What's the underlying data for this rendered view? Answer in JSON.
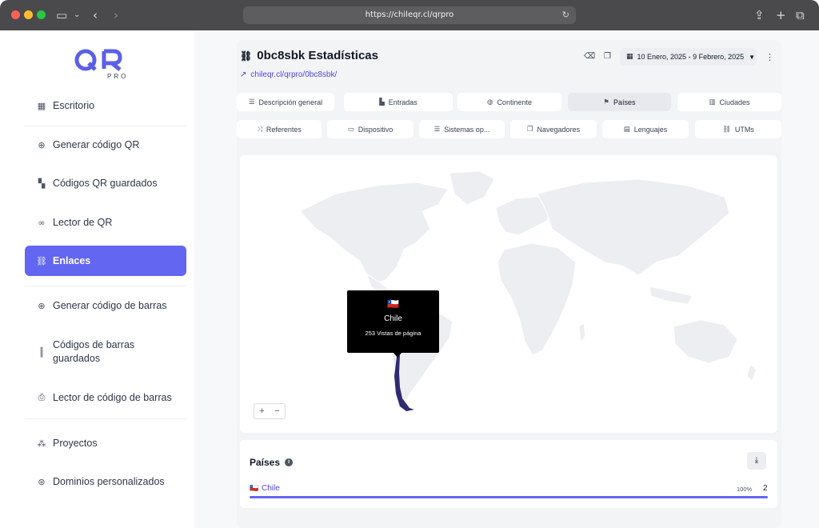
{
  "browser": {
    "url": "https://chileqr.cl/qrpro"
  },
  "sidebar": {
    "logo_text": "QR",
    "logo_sub": "PRO",
    "items": [
      {
        "label": "Escritorio",
        "icon": "table-icon"
      },
      {
        "label": "Generar código QR",
        "icon": "plus-circle-icon"
      },
      {
        "label": "Códigos QR guardados",
        "icon": "qrcode-icon"
      },
      {
        "label": "Lector de QR",
        "icon": "glasses-icon"
      },
      {
        "label": "Enlaces",
        "icon": "link-icon",
        "active": true
      },
      {
        "label": "Generar código de barras",
        "icon": "plus-circle-icon"
      },
      {
        "label": "Códigos de barras guardados",
        "icon": "barcode-icon"
      },
      {
        "label": "Lector de código de barras",
        "icon": "printer-icon"
      },
      {
        "label": "Proyectos",
        "icon": "project-icon"
      },
      {
        "label": "Dominios personalizados",
        "icon": "globe-icon"
      }
    ]
  },
  "header": {
    "title": "0bc8sbk Estadísticas",
    "link": "chileqr.cl/qrpro/0bc8sbk/",
    "date_range": "10 Enero, 2025 - 9 Febrero, 2025"
  },
  "tabs_row1": [
    {
      "label": "Descripción general",
      "icon": "list-icon"
    },
    {
      "label": "Entradas",
      "icon": "chart-icon"
    },
    {
      "label": "Continente",
      "icon": "globe-icon"
    },
    {
      "label": "Países",
      "icon": "flag-icon",
      "active": true
    },
    {
      "label": "Ciudades",
      "icon": "city-icon"
    }
  ],
  "tabs_row2": [
    {
      "label": "Referentes",
      "icon": "shuffle-icon"
    },
    {
      "label": "Dispositivo",
      "icon": "laptop-icon"
    },
    {
      "label": "Sistemas op...",
      "icon": "server-icon"
    },
    {
      "label": "Navegadores",
      "icon": "window-icon"
    },
    {
      "label": "Lenguajes",
      "icon": "language-icon"
    },
    {
      "label": "UTMs",
      "icon": "link-icon"
    }
  ],
  "map": {
    "tooltip_country": "Chile",
    "tooltip_flag": "🇨🇱",
    "tooltip_views": "253 Vistas de página",
    "zoom_in": "+",
    "zoom_out": "−",
    "land_color": "#eceef2",
    "highlight_color": "#2e2a73"
  },
  "countries": {
    "title": "Países",
    "rows": [
      {
        "flag": "🇨🇱",
        "country": "Chile",
        "percent": "100%",
        "percent_value": 1.0,
        "count": "2"
      }
    ]
  },
  "colors": {
    "accent": "#6366f1",
    "link": "#4f46e5"
  }
}
